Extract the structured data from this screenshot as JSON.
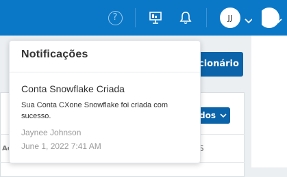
{
  "header": {
    "help_icon": "question-circle-icon",
    "presenter_icon": "presentation-board-icon",
    "bell_icon": "bell-icon",
    "avatar_initials": "JJ",
    "accent_color": "#0b78c7"
  },
  "background": {
    "primary_button_label": "cionário",
    "dropdown_button_label": "dos",
    "column_header_left": "Ac",
    "column_header_right": "S"
  },
  "notifications": {
    "title": "Notificações",
    "items": [
      {
        "title": "Conta Snowflake Criada",
        "message": "Sua Conta CXone Snowflake foi criada com sucesso.",
        "user": "Jaynee Johnson",
        "time": "June 1, 2022 7:41 AM"
      }
    ]
  }
}
